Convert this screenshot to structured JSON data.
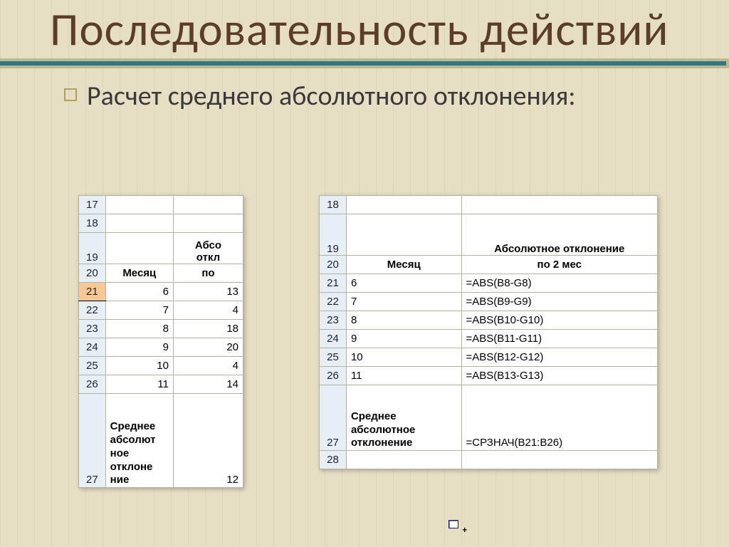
{
  "title": "Последовательность действий",
  "subtitle": "Расчет среднего абсолютного отклонения:",
  "left_table": {
    "row_labels": [
      "17",
      "18",
      "19",
      "20",
      "21",
      "22",
      "23",
      "24",
      "25",
      "26",
      "27"
    ],
    "header_partial_top": "Абсо",
    "header_partial_bot": "откл",
    "colA_header": "Месяц",
    "colB_header": "по",
    "rows": [
      {
        "a": "6",
        "b": "13"
      },
      {
        "a": "7",
        "b": "4"
      },
      {
        "a": "8",
        "b": "18"
      },
      {
        "a": "9",
        "b": "20"
      },
      {
        "a": "10",
        "b": "4"
      },
      {
        "a": "11",
        "b": "14"
      }
    ],
    "footer_label": "Среднее абсолютное отклонение",
    "footer_value": "12"
  },
  "right_table": {
    "row_labels": [
      "18",
      "19",
      "20",
      "21",
      "22",
      "23",
      "24",
      "25",
      "26",
      "27",
      "28"
    ],
    "header_top": "Абсолютное отклонение",
    "colA_header": "Месяц",
    "colB_header": "по 2 мес",
    "rows": [
      {
        "a": "6",
        "b": "=ABS(B8-G8)"
      },
      {
        "a": "7",
        "b": "=ABS(B9-G9)"
      },
      {
        "a": "8",
        "b": "=ABS(B10-G10)"
      },
      {
        "a": "9",
        "b": "=ABS(B11-G11)"
      },
      {
        "a": "10",
        "b": "=ABS(B12-G12)"
      },
      {
        "a": "11",
        "b": "=ABS(B13-G13)"
      }
    ],
    "footer_label": "Среднее абсолютное отклонение",
    "footer_value": "=СРЗНАЧ(B21:B26)"
  }
}
